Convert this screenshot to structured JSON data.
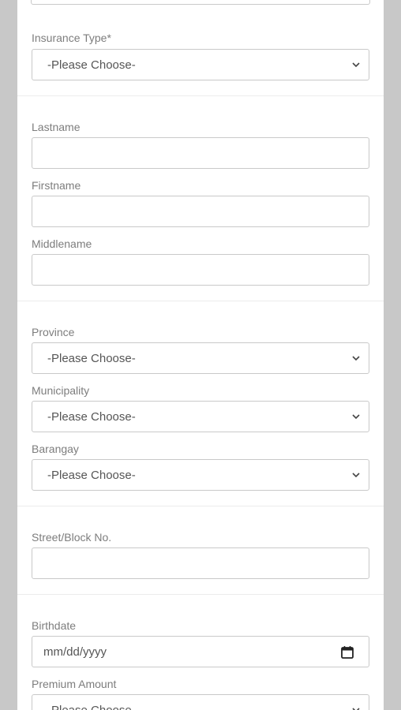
{
  "form": {
    "insurance_type": {
      "label": "Insurance Type*",
      "value": "-Please Choose-"
    },
    "lastname": {
      "label": "Lastname",
      "value": ""
    },
    "firstname": {
      "label": "Firstname",
      "value": ""
    },
    "middlename": {
      "label": "Middlename",
      "value": ""
    },
    "province": {
      "label": "Province",
      "value": "-Please Choose-"
    },
    "municipality": {
      "label": "Municipality",
      "value": "-Please Choose-"
    },
    "barangay": {
      "label": "Barangay",
      "value": "-Please Choose-"
    },
    "street": {
      "label": "Street/Block No.",
      "value": ""
    },
    "birthdate": {
      "label": "Birthdate",
      "placeholder": "mm/dd/yyyy"
    },
    "premium_amount": {
      "label": "Premium Amount",
      "value": "-Please Choose-"
    }
  },
  "icons": {
    "select_arrow": "chevron-down-icon",
    "date_picker": "calendar-icon"
  },
  "colors": {
    "background": "#c8c8c8",
    "panel": "#ffffff",
    "border": "#c9c9c9",
    "label_text": "#7d7d7d",
    "value_text": "#555555"
  }
}
